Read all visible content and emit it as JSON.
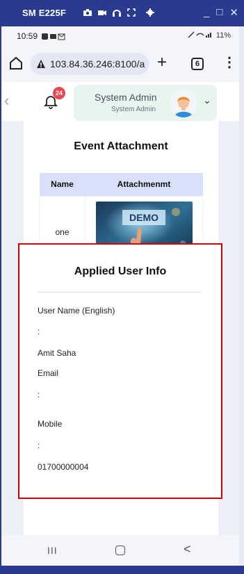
{
  "window": {
    "title": "SM E225F",
    "controls": [
      "_",
      "□",
      "✕"
    ]
  },
  "status": {
    "time": "10:59",
    "right": "11%"
  },
  "browser": {
    "url": "103.84.36.246:8100/a",
    "tab_count": "6"
  },
  "header": {
    "notification_count": "24",
    "user_name": "System Admin",
    "user_role": "System Admin"
  },
  "event": {
    "title": "Event Attachment",
    "columns": [
      "Name",
      "Attachmenmt"
    ],
    "rows": [
      {
        "name": "one",
        "image_label": "DEMO"
      }
    ]
  },
  "applied": {
    "title": "Applied User Info",
    "user_name_label": "User Name (English)",
    "colon": ":",
    "user_name_value": "Amit Saha",
    "email_label": "Email",
    "email_value": "",
    "mobile_label": "Mobile",
    "mobile_value": "01700000004"
  },
  "nav": {
    "recent_glyph": "III",
    "back_glyph": "<"
  },
  "colors": {
    "accent_border": "#d40000",
    "table_header_bg": "#d9e0f9",
    "frame_bg": "#2a3b8f",
    "badge": "#e5484d"
  }
}
